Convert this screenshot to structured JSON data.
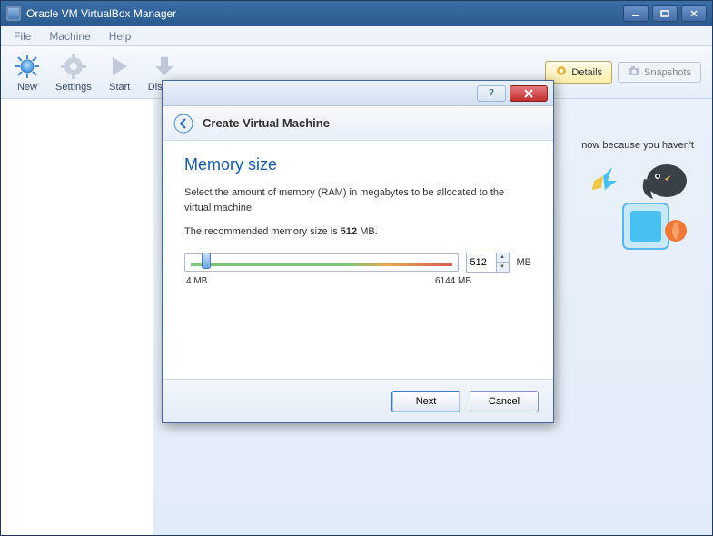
{
  "window": {
    "title": "Oracle VM VirtualBox Manager"
  },
  "menu": {
    "file": "File",
    "machine": "Machine",
    "help": "Help"
  },
  "toolbar": {
    "new": "New",
    "settings": "Settings",
    "start": "Start",
    "discard": "Discard",
    "details": "Details",
    "snapshots": "Snapshots"
  },
  "main": {
    "hint_text": "now because you haven't"
  },
  "dialog": {
    "header_title": "Create Virtual Machine",
    "heading": "Memory size",
    "description": "Select the amount of memory (RAM) in megabytes to be allocated to the virtual machine.",
    "recommended_prefix": "The recommended memory size is ",
    "recommended_value": "512",
    "recommended_suffix": " MB.",
    "memory_value": "512",
    "unit": "MB",
    "min_label": "4 MB",
    "max_label": "6144 MB",
    "next": "Next",
    "cancel": "Cancel"
  }
}
